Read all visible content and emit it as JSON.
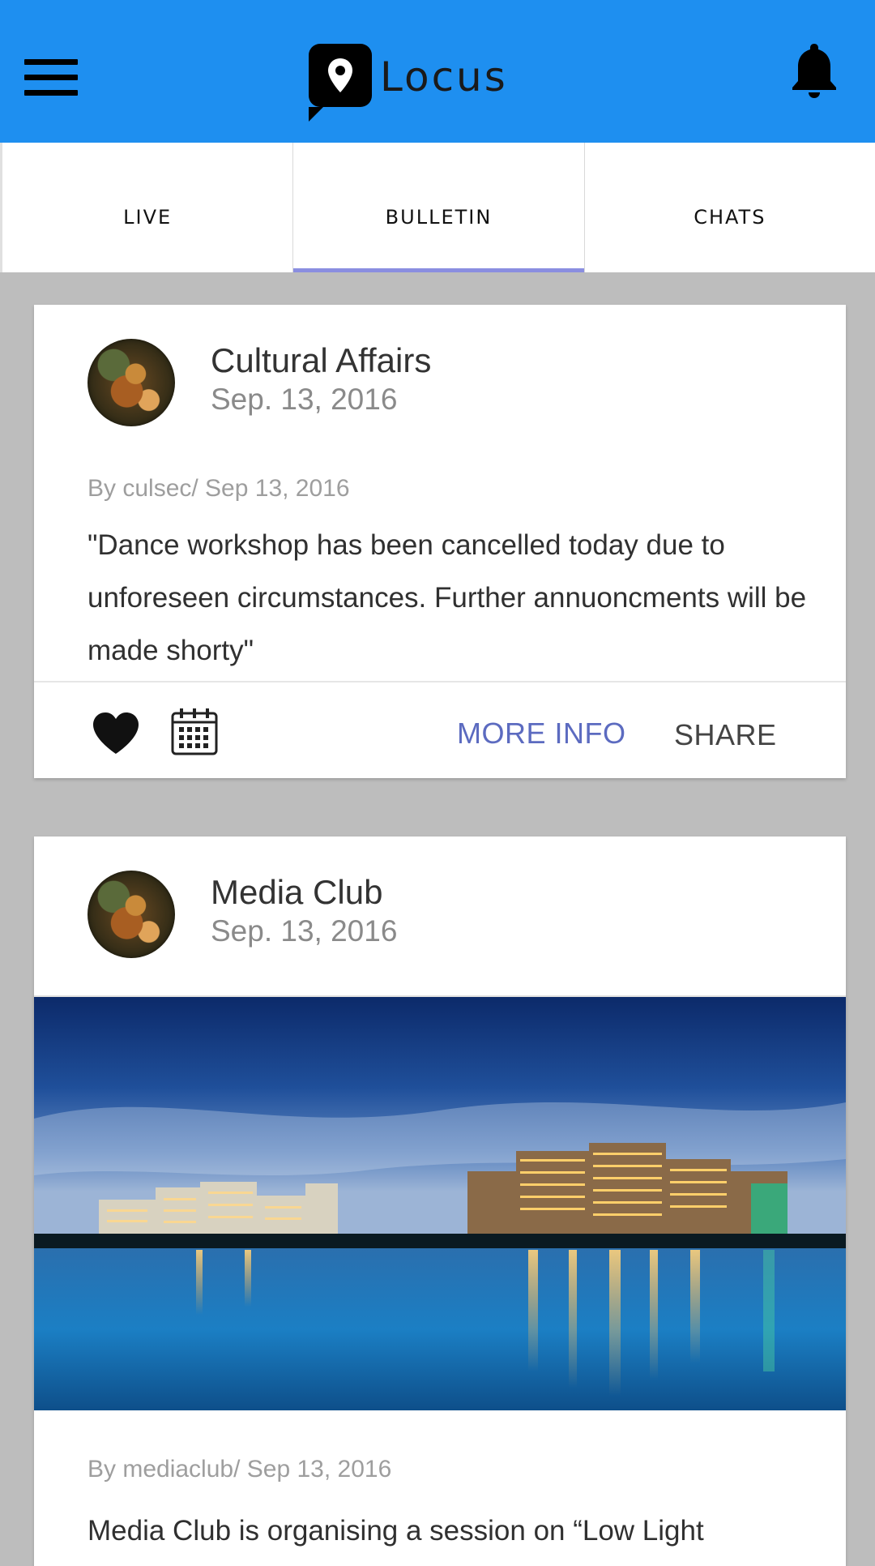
{
  "app": {
    "title": "Locus",
    "menu_icon": "hamburger-menu-icon",
    "notification_icon": "bell-icon",
    "brand_color": "#1e8ff0"
  },
  "tabs": [
    {
      "label": "LIVE",
      "active": false
    },
    {
      "label": "BULLETIN",
      "active": true
    },
    {
      "label": "CHATS",
      "active": false
    }
  ],
  "posts": [
    {
      "org": "Cultural Affairs",
      "date": "Sep. 13, 2016",
      "byline": "By culsec/ Sep 13, 2016",
      "text": "\"Dance workshop has been cancelled today due to unforeseen circumstances. Further annuoncments will be made shorty\"",
      "actions": {
        "like_icon": "heart-icon",
        "calendar_icon": "calendar-icon",
        "more_info": "MORE INFO",
        "share": "SHARE"
      }
    },
    {
      "org": "Media Club",
      "date": "Sep. 13, 2016",
      "byline": "By mediaclub/ Sep 13, 2016",
      "text": "Media Club is organising a session on “Low Light"
    }
  ],
  "colors": {
    "accent": "#5c6bc0",
    "tab_indicator": "#8a8ee0",
    "background": "#bdbdbd"
  }
}
